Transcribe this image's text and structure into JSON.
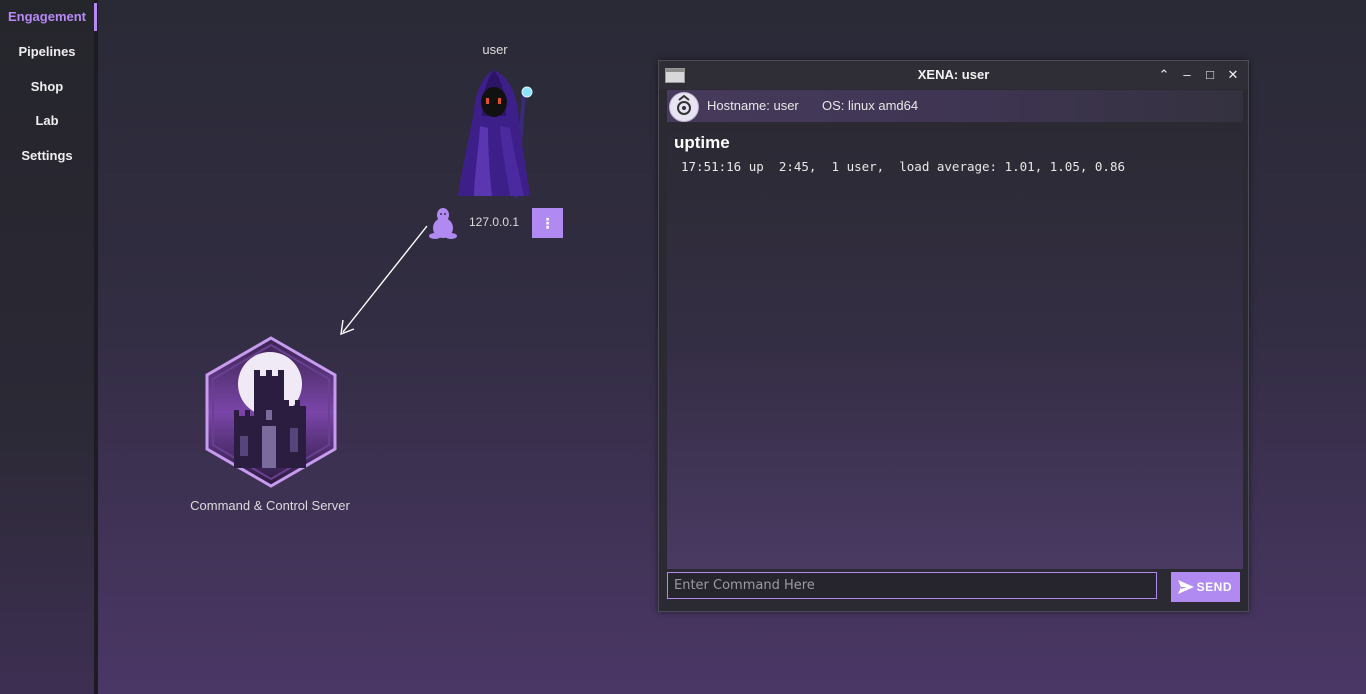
{
  "sidebar": {
    "items": [
      {
        "label": "Engagement",
        "active": true
      },
      {
        "label": "Pipelines",
        "active": false
      },
      {
        "label": "Shop",
        "active": false
      },
      {
        "label": "Lab",
        "active": false
      },
      {
        "label": "Settings",
        "active": false
      }
    ]
  },
  "graph": {
    "agent_node": {
      "name": "user",
      "ip": "127.0.0.1",
      "menu_icon": "⋮",
      "os_icon": "linux-tux-icon"
    },
    "server_node": {
      "label": "Command & Control Server"
    }
  },
  "terminal": {
    "title": "XENA: user",
    "controls": {
      "collapse": "⌃",
      "minimize": "–",
      "maximize": "□",
      "close": "✕"
    },
    "hostname": "Hostname: user",
    "os": "OS: linux amd64",
    "last_command": "uptime",
    "output": "17:51:16 up  2:45,  1 user,  load average: 1.01, 1.05, 0.86",
    "input": {
      "value": "",
      "placeholder": "Enter Command Here"
    },
    "send_label": "SEND"
  },
  "colors": {
    "accent": "#b08af0",
    "active_nav": "#b889f5"
  }
}
